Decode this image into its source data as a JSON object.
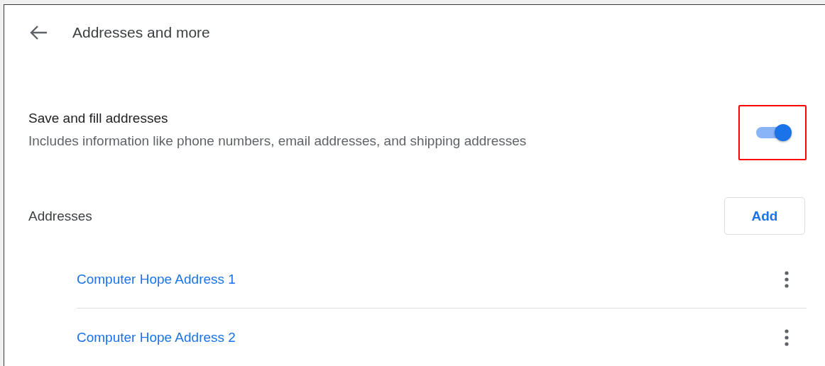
{
  "header": {
    "title": "Addresses and more"
  },
  "setting": {
    "label": "Save and fill addresses",
    "description": "Includes information like phone numbers, email addresses, and shipping addresses",
    "on": true,
    "highlighted": true
  },
  "addresses": {
    "heading": "Addresses",
    "add_button": "Add",
    "items": [
      {
        "name": "Computer Hope Address 1"
      },
      {
        "name": "Computer Hope Address 2"
      }
    ]
  }
}
